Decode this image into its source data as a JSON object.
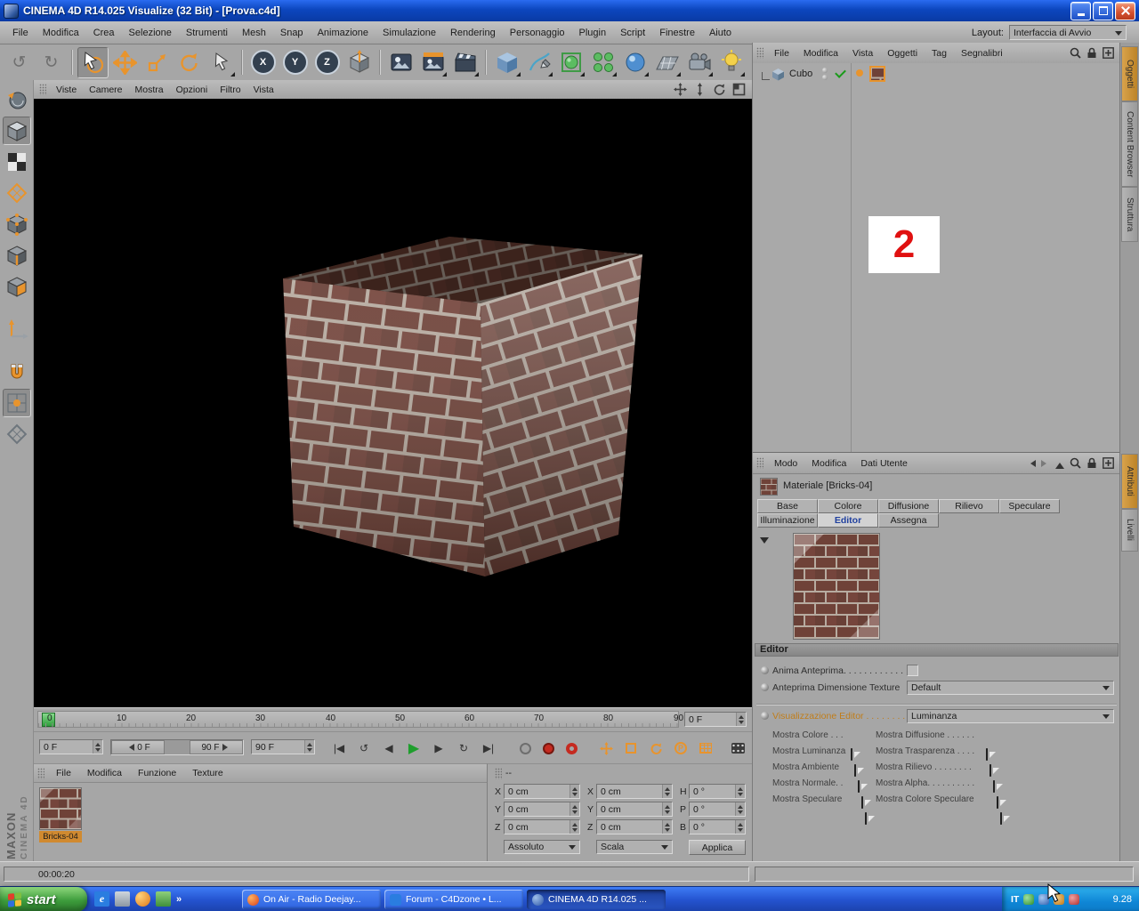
{
  "titlebar": {
    "title": "CINEMA 4D R14.025 Visualize (32 Bit) - [Prova.c4d]"
  },
  "menubar": {
    "items": [
      "File",
      "Modifica",
      "Crea",
      "Selezione",
      "Strumenti",
      "Mesh",
      "Snap",
      "Animazione",
      "Simulazione",
      "Rendering",
      "Personaggio",
      "Plugin",
      "Script",
      "Finestre",
      "Aiuto"
    ],
    "layout_label": "Layout:",
    "layout_value": "Interfaccia di Avvio"
  },
  "toolbar": {
    "axis_locks": [
      "X",
      "Y",
      "Z"
    ],
    "icon_names": [
      "undo",
      "redo",
      "live-selection",
      "move",
      "scale",
      "rotate",
      "last-tool",
      "lock-x",
      "lock-y",
      "lock-z",
      "coordinate-system",
      "render-view",
      "render-picture-viewer",
      "render-settings",
      "add-cube",
      "add-spline",
      "add-generator",
      "add-array",
      "add-environment",
      "add-floor",
      "add-camera",
      "add-light"
    ]
  },
  "left_toolbar": {
    "icon_names": [
      "make-editable",
      "model-mode",
      "texture-mode",
      "workplane-mode",
      "points-mode",
      "edges-mode",
      "polygons-mode",
      "axis-m",
      "snap-magnet",
      "snap-enable",
      "workplane-snap"
    ]
  },
  "viewport": {
    "menu": [
      "Viste",
      "Camere",
      "Mostra",
      "Opzioni",
      "Filtro",
      "Vista"
    ]
  },
  "timeline": {
    "ticks": [
      "0",
      "10",
      "20",
      "30",
      "40",
      "50",
      "60",
      "70",
      "80",
      "90"
    ],
    "frame_box": "0 F"
  },
  "transport": {
    "start_field": "0 F",
    "range_start": "0 F",
    "range_end": "90 F",
    "end_field": "90 F",
    "param_letter": "P"
  },
  "glyphs": {
    "undo": "↺",
    "redo": "↻",
    "goto_start": "|◀",
    "loop_back": "↺",
    "prev_frame": "◀",
    "play": "▶",
    "next_frame": "▶",
    "loop": "↻",
    "goto_end": "▶|",
    "overflow": "»",
    "ie": "e"
  },
  "object_manager": {
    "menu": [
      "File",
      "Modifica",
      "Vista",
      "Oggetti",
      "Tag",
      "Segnalibri"
    ],
    "object_name": "Cubo",
    "marker": "2"
  },
  "side_tabs": {
    "top": [
      "Oggetti",
      "Content Browser",
      "Struttura"
    ],
    "middle": [
      "Attributi",
      "Livelli"
    ]
  },
  "attribute_manager": {
    "menu": [
      "Modo",
      "Modifica",
      "Dati Utente"
    ],
    "material_title": "Materiale [Bricks-04]",
    "tabs_row1": [
      "Base",
      "Colore",
      "Diffusione",
      "Rilievo",
      "Speculare"
    ],
    "tabs_row2": [
      "Illuminazione",
      "Editor",
      "Assegna"
    ],
    "section_header": "Editor",
    "anima_label": "Anima Anteprima. . . . . . . . . . . .",
    "texture_size_label": "Anteprima Dimensione Texture",
    "texture_size_value": "Default",
    "editor_display_label": "Visualizzazione Editor . . . . . . . .",
    "editor_display_value": "Luminanza",
    "toggles_left": [
      "Mostra Colore . . .",
      "Mostra Luminanza",
      "Mostra Ambiente",
      "Mostra Normale. .",
      "Mostra Speculare"
    ],
    "toggles_right": [
      "Mostra Diffusione . . . . . .",
      "Mostra Trasparenza . . . .",
      "Mostra Rilievo . . . . . . . .",
      "Mostra Alpha. . . . . . . . . .",
      "Mostra Colore Speculare"
    ]
  },
  "materials_manager": {
    "menu": [
      "File",
      "Modifica",
      "Funzione",
      "Texture"
    ],
    "material_name": "Bricks-04"
  },
  "coordinates": {
    "header": "--",
    "rows": [
      {
        "l1": "X",
        "v1": "0 cm",
        "l2": "X",
        "v2": "0 cm",
        "l3": "H",
        "v3": "0 °"
      },
      {
        "l1": "Y",
        "v1": "0 cm",
        "l2": "Y",
        "v2": "0 cm",
        "l3": "P",
        "v3": "0 °"
      },
      {
        "l1": "Z",
        "v1": "0 cm",
        "l2": "Z",
        "v2": "0 cm",
        "l3": "B",
        "v3": "0 °"
      }
    ],
    "mode_position": "Assoluto",
    "mode_size": "Scala",
    "apply_label": "Applica"
  },
  "statusbar": {
    "time": "00:00:20"
  },
  "branding": {
    "line1": "MAXON",
    "line2": "CINEMA 4D"
  },
  "taskbar": {
    "start_label": "start",
    "tasks": [
      "On Air - Radio Deejay...",
      "Forum - C4Dzone • L...",
      "CINEMA 4D R14.025 ..."
    ],
    "tray_language": "IT",
    "clock": "9.28"
  },
  "colors": {
    "accent_orange": "#e8942d",
    "brick": "#6f4238",
    "mortar": "#b7aba0",
    "play_green": "#1f9e2d",
    "record_red": "#c52a20",
    "xp_blue": "#2453cf",
    "marker_red": "#e01010"
  }
}
